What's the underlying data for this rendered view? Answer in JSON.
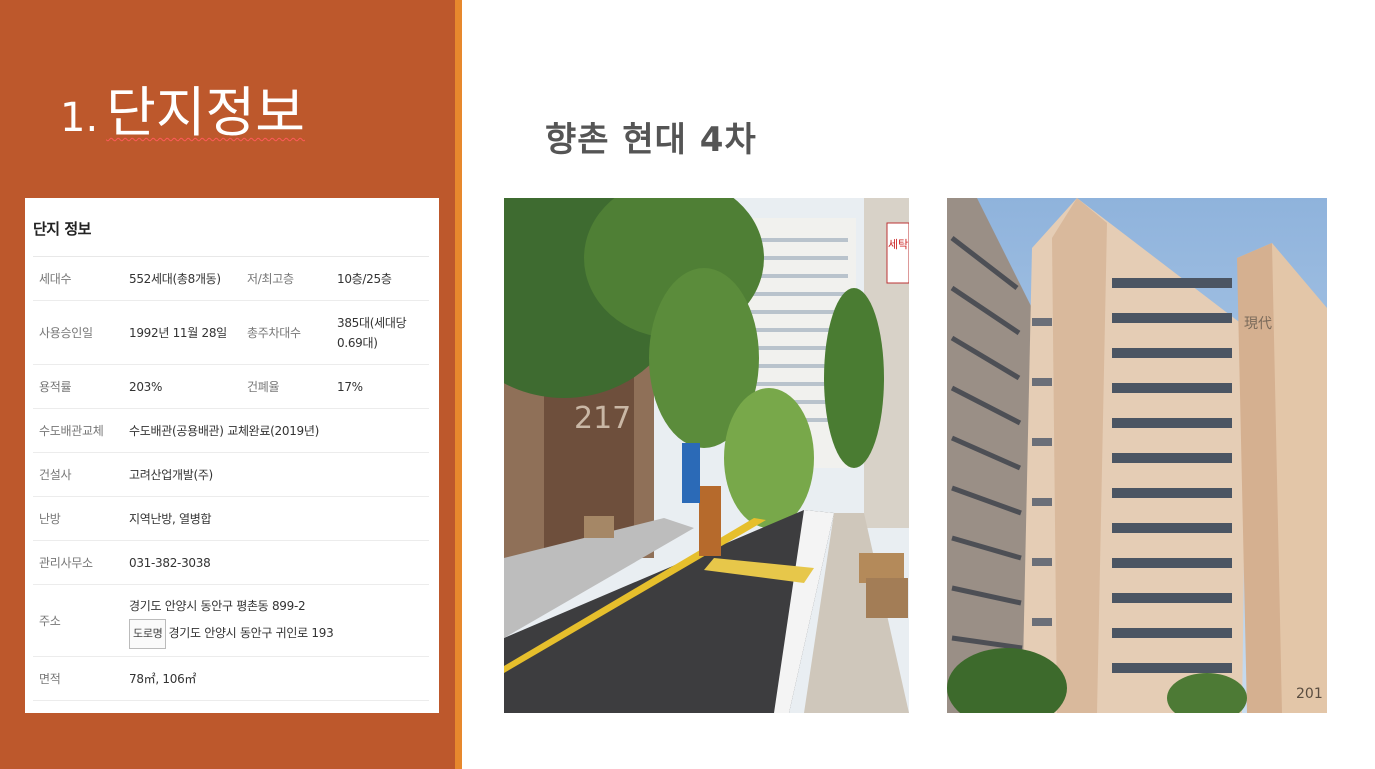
{
  "title": {
    "number": "1.",
    "text": "단지정보"
  },
  "heading": "향촌 현대 4차",
  "info": {
    "title": "단지 정보",
    "rows": [
      {
        "label": "세대수",
        "value": "552세대(총8개동)",
        "label2": "저/최고층",
        "value2": "10층/25층"
      },
      {
        "label": "사용승인일",
        "value": "1992년 11월 28일",
        "label2": "총주차대수",
        "value2": "385대(세대당 0.69대)"
      },
      {
        "label": "용적률",
        "value": "203%",
        "label2": "건폐율",
        "value2": "17%"
      },
      {
        "label": "수도배관교체",
        "value": "수도배관(공용배관) 교체완료(2019년)"
      },
      {
        "label": "건설사",
        "value": "고려산업개발(주)"
      },
      {
        "label": "난방",
        "value": "지역난방, 열병합"
      },
      {
        "label": "관리사무소",
        "value": "031-382-3038"
      },
      {
        "label": "주소",
        "value": "경기도 안양시 동안구 평촌동 899-2",
        "road_tag": "도로명",
        "road_address": "경기도 안양시 동안구 귀인로 193"
      },
      {
        "label": "면적",
        "value": "78㎡, 106㎡"
      }
    ]
  },
  "photos": {
    "street": {
      "building_number": "217",
      "sign_text": "세탁"
    },
    "towers": {
      "building_number": "201",
      "brand_text": "現代"
    }
  },
  "colors": {
    "panel": "#bd582c",
    "accent": "#e7882d",
    "heading": "#555555"
  }
}
